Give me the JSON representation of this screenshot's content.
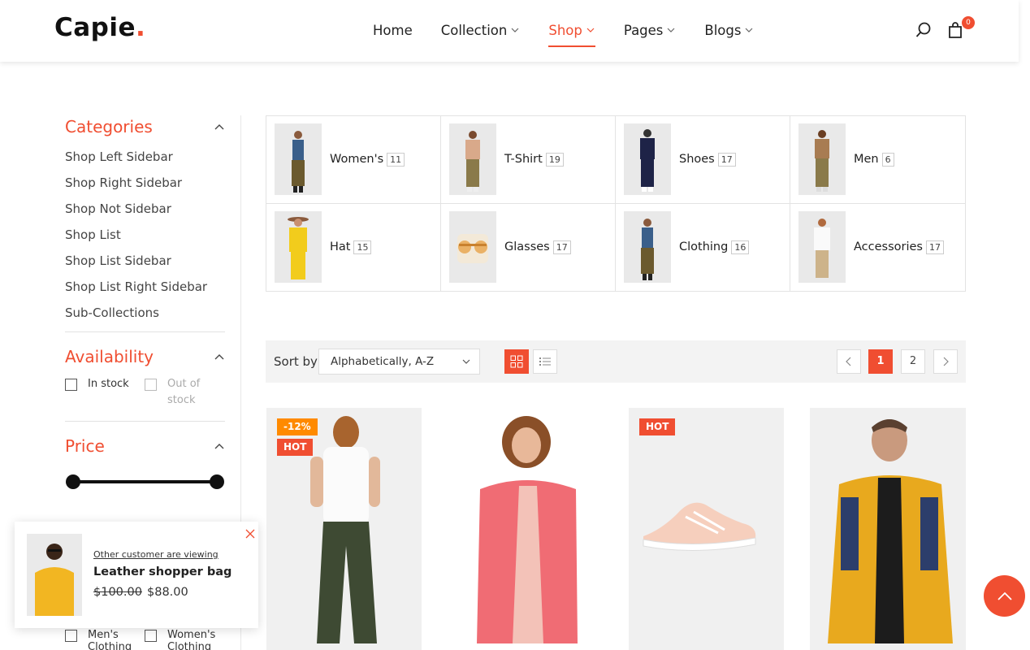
{
  "header": {
    "logo": "Capie",
    "logo_dot": ".",
    "nav": [
      {
        "label": "Home",
        "dropdown": false
      },
      {
        "label": "Collection",
        "dropdown": true
      },
      {
        "label": "Shop",
        "dropdown": true,
        "active": true
      },
      {
        "label": "Pages",
        "dropdown": true
      },
      {
        "label": "Blogs",
        "dropdown": true
      }
    ],
    "cart_count": "0"
  },
  "sidebar": {
    "categories_title": "Categories",
    "categories": [
      "Shop Left Sidebar",
      "Shop Right Sidebar",
      "Shop Not Sidebar",
      "Shop List",
      "Shop List Sidebar",
      "Shop List Right Sidebar",
      "Sub-Collections"
    ],
    "availability_title": "Availability",
    "availability": [
      {
        "label": "In stock",
        "enabled": true
      },
      {
        "label": "Out of stock",
        "enabled": false
      }
    ],
    "price_title": "Price",
    "type_options": [
      "Men's Clothing",
      "Women's Clothing"
    ]
  },
  "category_grid": [
    {
      "name": "Women's",
      "count": "11"
    },
    {
      "name": "T-Shirt",
      "count": "19"
    },
    {
      "name": "Shoes",
      "count": "17"
    },
    {
      "name": "Men",
      "count": "6"
    },
    {
      "name": "Hat",
      "count": "15"
    },
    {
      "name": "Glasses",
      "count": "17"
    },
    {
      "name": "Clothing",
      "count": "16"
    },
    {
      "name": "Accessories",
      "count": "17"
    }
  ],
  "toolbar": {
    "sort_label": "Sort by",
    "sort_value": "Alphabetically, A-Z",
    "pages": [
      "1",
      "2"
    ],
    "current_page": "1"
  },
  "products": [
    {
      "badges": [
        "-12%",
        "HOT"
      ]
    },
    {
      "badges": []
    },
    {
      "badges": [
        "HOT"
      ]
    },
    {
      "badges": []
    }
  ],
  "popup": {
    "note": "Other customer are viewing",
    "product": "Leather shopper bag",
    "old_price": "$100.00",
    "new_price": "$88.00"
  },
  "colors": {
    "accent": "#f04e31",
    "sale": "#ff8a00"
  }
}
